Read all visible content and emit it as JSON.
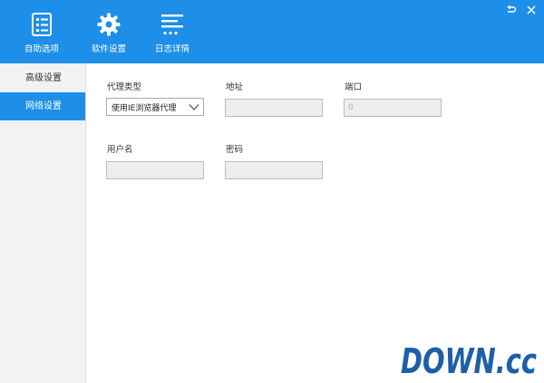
{
  "toolbar": {
    "items": [
      {
        "label": "自助选项",
        "icon": "checklist-icon"
      },
      {
        "label": "软件设置",
        "icon": "gear-icon"
      },
      {
        "label": "日志详情",
        "icon": "log-lines-icon"
      }
    ]
  },
  "window_controls": {
    "restore_icon": "restore-icon",
    "close_icon": "close-icon"
  },
  "sidebar": {
    "items": [
      {
        "label": "高级设置",
        "active": false
      },
      {
        "label": "网络设置",
        "active": true
      }
    ]
  },
  "proxy": {
    "type_label": "代理类型",
    "type_value": "使用IE浏览器代理",
    "address_label": "地址",
    "address_value": "",
    "port_label": "端口",
    "port_placeholder": "0",
    "username_label": "用户名",
    "username_value": "",
    "password_label": "密码",
    "password_value": ""
  },
  "watermark": {
    "text": "DOWN.cc"
  },
  "colors": {
    "accent": "#1d8fe8",
    "sidebar_bg": "#f2f2f2",
    "input_bg": "#eeeeee",
    "watermark_blue": "#1d5fa8",
    "watermark_orange": "#f08a1c"
  }
}
